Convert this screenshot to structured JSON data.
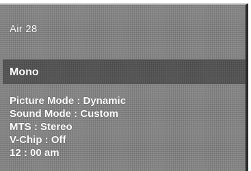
{
  "osd": {
    "channel": "Air 28",
    "audio": "Mono",
    "info": [
      "Picture Mode : Dynamic",
      "Sound Mode : Custom",
      "MTS : Stereo",
      "V-Chip : Off",
      "12 : 00 am"
    ]
  }
}
